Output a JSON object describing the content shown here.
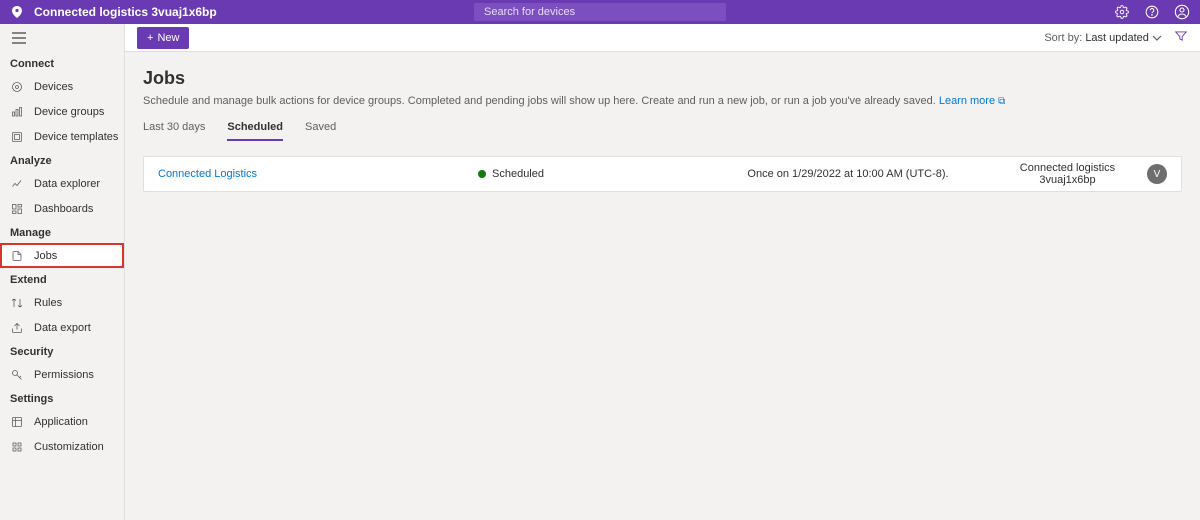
{
  "header": {
    "app_title": "Connected logistics 3vuaj1x6bp",
    "search_placeholder": "Search for devices"
  },
  "sidebar": {
    "groups": [
      {
        "label": "Connect",
        "items": [
          {
            "label": "Devices",
            "icon": "devices-icon"
          },
          {
            "label": "Device groups",
            "icon": "device-groups-icon"
          },
          {
            "label": "Device templates",
            "icon": "device-templates-icon"
          }
        ]
      },
      {
        "label": "Analyze",
        "items": [
          {
            "label": "Data explorer",
            "icon": "data-explorer-icon"
          },
          {
            "label": "Dashboards",
            "icon": "dashboards-icon"
          }
        ]
      },
      {
        "label": "Manage",
        "items": [
          {
            "label": "Jobs",
            "icon": "jobs-icon",
            "active": true,
            "highlight": true
          }
        ]
      },
      {
        "label": "Extend",
        "items": [
          {
            "label": "Rules",
            "icon": "rules-icon"
          },
          {
            "label": "Data export",
            "icon": "data-export-icon"
          }
        ]
      },
      {
        "label": "Security",
        "items": [
          {
            "label": "Permissions",
            "icon": "permissions-icon"
          }
        ]
      },
      {
        "label": "Settings",
        "items": [
          {
            "label": "Application",
            "icon": "application-icon"
          },
          {
            "label": "Customization",
            "icon": "customization-icon"
          }
        ]
      }
    ]
  },
  "command_bar": {
    "new_label": "New",
    "sort_prefix": "Sort by:",
    "sort_value": "Last updated"
  },
  "page": {
    "title": "Jobs",
    "description_pre": "Schedule and manage bulk actions for device groups. Completed and pending jobs will show up here. Create and run a new job, or run a job you've already saved. ",
    "learn_more": "Learn more",
    "tabs": [
      "Last 30 days",
      "Scheduled",
      "Saved"
    ],
    "active_tab": 1
  },
  "jobs": [
    {
      "name": "Connected Logistics",
      "status": "Scheduled",
      "schedule": "Once on 1/29/2022 at 10:00 AM (UTC-8).",
      "app": "Connected logistics 3vuaj1x6bp",
      "avatar_initial": "V"
    }
  ]
}
